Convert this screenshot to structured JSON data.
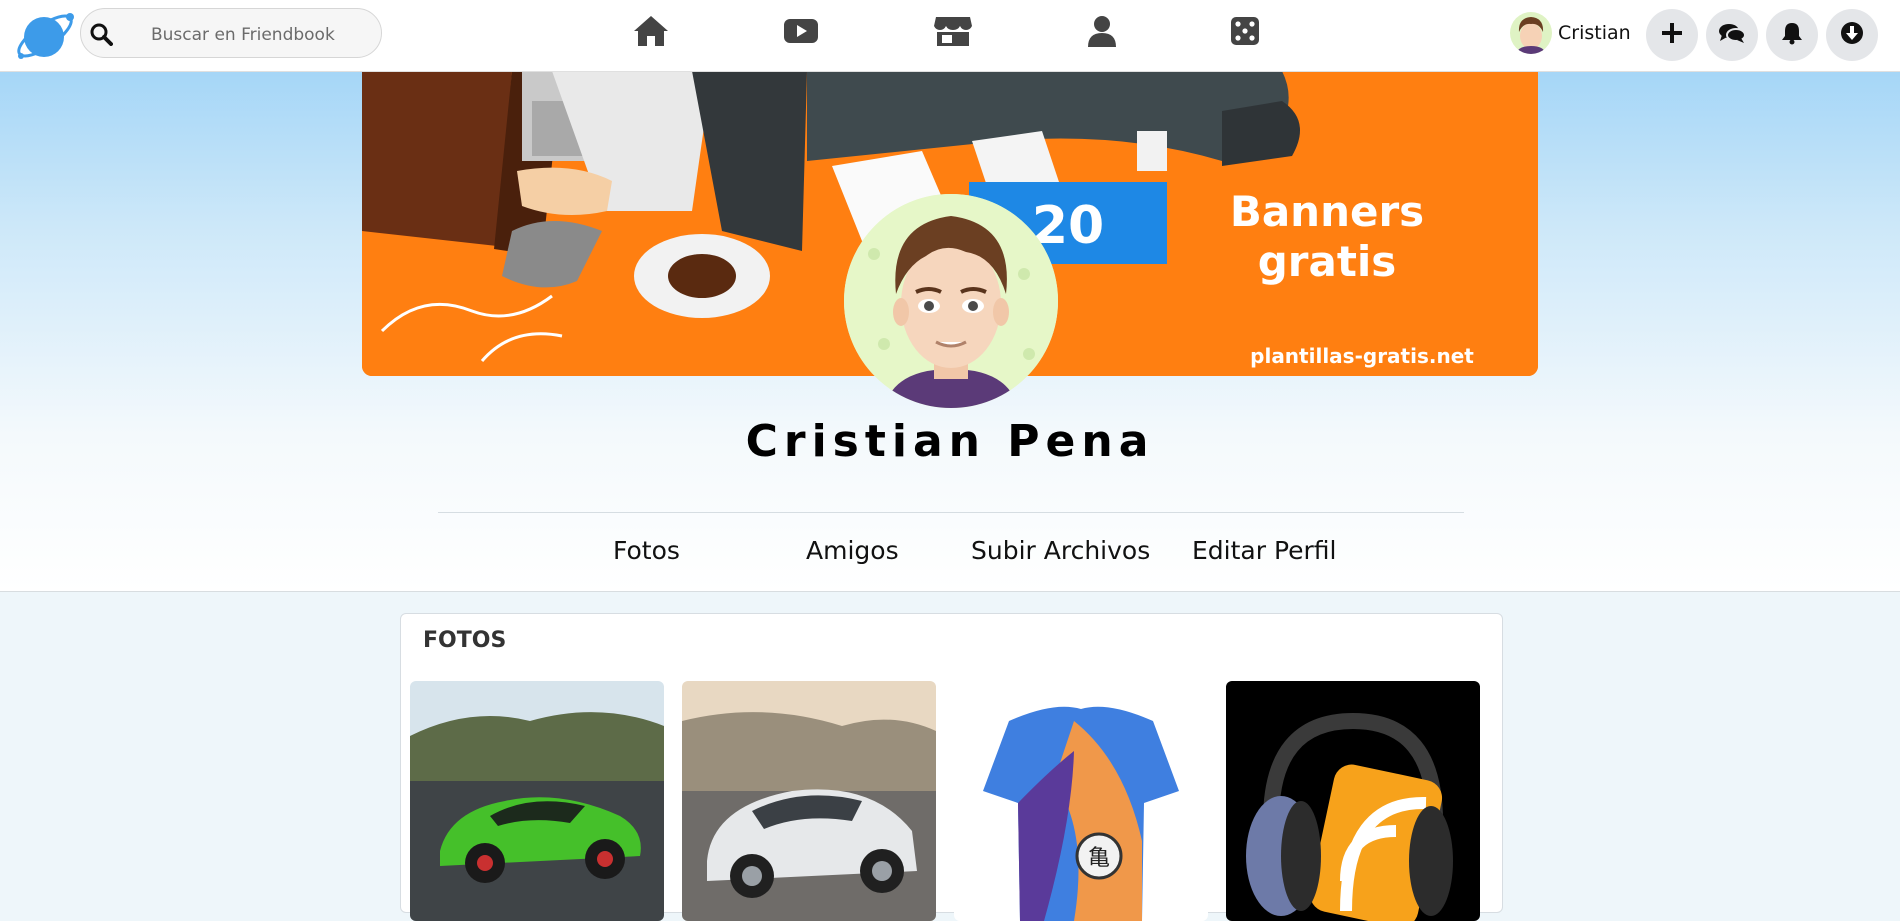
{
  "app": {
    "name": "Friendbook"
  },
  "search": {
    "placeholder": "Buscar en Friendbook",
    "value": ""
  },
  "nav": {
    "icons": [
      "home-icon",
      "video-icon",
      "marketplace-icon",
      "profile-icon",
      "games-icon"
    ]
  },
  "user": {
    "name": "Cristian"
  },
  "actions": [
    "plus-icon",
    "messages-icon",
    "bell-icon",
    "download-icon"
  ],
  "cover": {
    "badge_number": "20",
    "headline_1": "Banners",
    "headline_2": "gratis",
    "site": "plantillas-gratis.net"
  },
  "profile": {
    "full_name": "Cristian Pena"
  },
  "tabs": [
    {
      "label": "Fotos"
    },
    {
      "label": "Amigos"
    },
    {
      "label": "Subir Archivos"
    },
    {
      "label": "Editar Perfil"
    }
  ],
  "photos": {
    "title": "FOTOS",
    "items": [
      "green-sports-car",
      "white-sedan",
      "dragon-ball-shirt",
      "rss-headphones"
    ]
  },
  "colors": {
    "cover_orange": "#ff7f11",
    "badge_blue": "#1e88e5",
    "logo_blue": "#3d9be9",
    "nav_icon": "#444444"
  }
}
